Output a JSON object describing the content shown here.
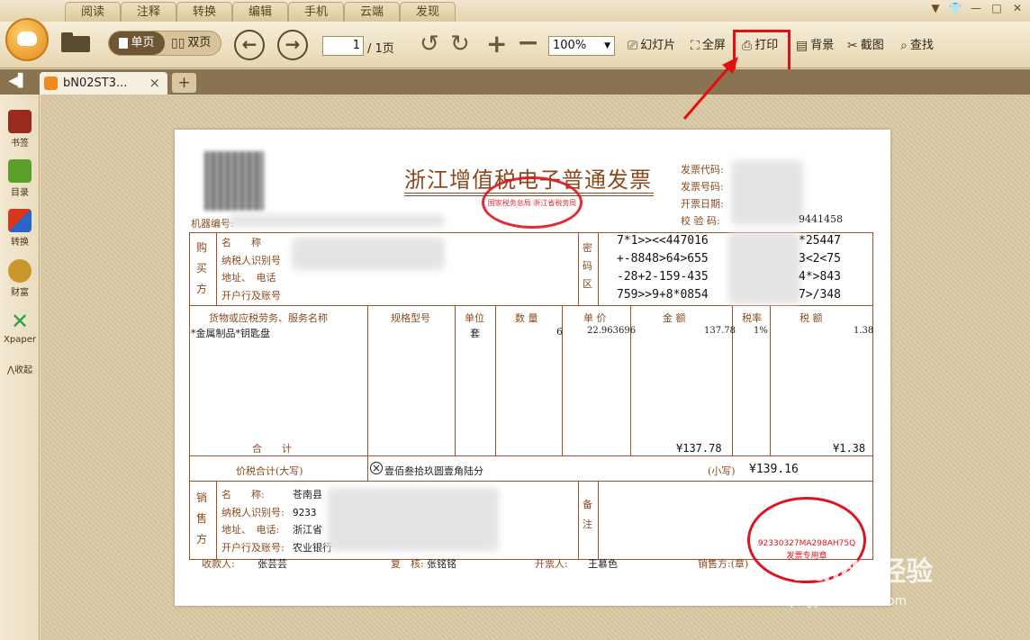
{
  "menu": {
    "tabs": [
      "阅读",
      "注释",
      "转换",
      "编辑",
      "手机",
      "云端",
      "发现"
    ]
  },
  "toolbar": {
    "single_page": "单页",
    "double_page": "双页",
    "page_current": "1",
    "page_total": "/ 1页",
    "zoom": "100%",
    "slideshow": "幻灯片",
    "fullscreen": "全屏",
    "print": "打印",
    "background": "背景",
    "screenshot": "截图",
    "search": "查找"
  },
  "tab": {
    "title": "bN02ST3...",
    "close": "×",
    "add": "+"
  },
  "sidebar": {
    "items": [
      "书签",
      "目录",
      "转换",
      "财富",
      "Xpaper"
    ],
    "collapse": "收起"
  },
  "invoice": {
    "title": "浙江增值税电子普通发票",
    "machine_label": "机器编号:",
    "meta_labels": [
      "发票代码:",
      "发票号码:",
      "开票日期:",
      "校 验 码:"
    ],
    "check_code_tail": "9441458",
    "buyer_side": "购买方",
    "buyer_fields": [
      "名　　称",
      "纳税人识别号",
      "地址、　电话",
      "开户行及账号"
    ],
    "cipher_side": "密码区",
    "cipher_lines": [
      "7*1>><<447016",
      "+-8848>64>655",
      "-28+2-159-435",
      "759>>9+8*0854"
    ],
    "cipher_tails": [
      "*25447",
      "3<2<75",
      "4*>843",
      "7>/348"
    ],
    "headers": [
      "货物或应税劳务、服务名称",
      "规格型号",
      "单位",
      "数 量",
      "单 价",
      "金 额",
      "税率",
      "税 额"
    ],
    "item": {
      "name": "*金属制品*钥匙盘",
      "unit": "套",
      "qty": "6",
      "price": "22.963696",
      "amount": "137.78",
      "rate": "1%",
      "tax": "1.38"
    },
    "total_label": "合　　计",
    "total_amount": "¥137.78",
    "total_tax": "¥1.38",
    "sum_label": "价税合计(大写)",
    "sum_words": "壹佰叁拾玖圆壹角陆分",
    "sum_small_label": "(小写)",
    "sum_small": "¥139.16",
    "seller_side": "销售方",
    "seller_fields": [
      "名　　称:",
      "纳税人识别号:",
      "地址、　电话:",
      "开户行及账号:"
    ],
    "seller_values": [
      "苍南县",
      "9233",
      "浙江省",
      "农业银行"
    ],
    "remark_side": "备注",
    "stamp_tax": "国家税务总局 浙江省税务局",
    "stamp_seller": "92330327MA298AH75Q",
    "stamp_seller_bottom": "发票专用章",
    "footer": {
      "payee_label": "收款人:",
      "payee": "张芸芸",
      "reviewer_label": "复　核:",
      "reviewer": "张铭铭",
      "drawer_label": "开票人:",
      "drawer": "王慕色",
      "seller_label": "销售方:(章)"
    }
  },
  "watermark": {
    "brand": "Baidu经验",
    "url": "jingyan.baidu.com"
  }
}
